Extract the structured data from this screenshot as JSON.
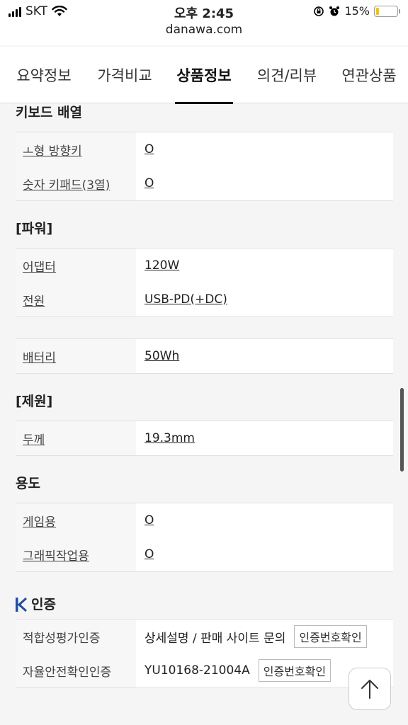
{
  "status": {
    "carrier": "SKT",
    "time": "오후 2:45",
    "battery_text": "15%",
    "battery_level": 0.15,
    "battery_color": "#f5c400"
  },
  "url": "danawa.com",
  "tabs": [
    {
      "label": "요약정보"
    },
    {
      "label": "가격비교"
    },
    {
      "label": "상품정보",
      "active": true
    },
    {
      "label": "의견/리뷰"
    },
    {
      "label": "연관상품"
    }
  ],
  "sections": {
    "keyboard": {
      "title": "키보드 배열",
      "rows": [
        {
          "key": "ㅗ형 방향키",
          "value": "O"
        },
        {
          "key": "숫자 키패드(3열)",
          "value": "O"
        }
      ]
    },
    "power": {
      "title": "[파워]",
      "rows": [
        {
          "key": "어댑터",
          "value": "120W"
        },
        {
          "key": "전원",
          "value": "USB-PD(+DC)"
        }
      ],
      "battery_row": {
        "key": "배터리",
        "value": "50Wh"
      }
    },
    "spec": {
      "title": "[제원]",
      "rows": [
        {
          "key": "두께",
          "value": "19.3mm"
        }
      ]
    },
    "usage": {
      "title": "용도",
      "rows": [
        {
          "key": "게임용",
          "value": "O"
        },
        {
          "key": "그래픽작업용",
          "value": "O"
        }
      ]
    },
    "cert": {
      "title": "인증",
      "rows": [
        {
          "key": "적합성평가인증",
          "value": "상세설명 / 판매 사이트 문의",
          "button": "인증번호확인"
        },
        {
          "key": "자율안전확인인증",
          "value": "YU10168-21004A",
          "button": "인증번호확인"
        }
      ]
    }
  }
}
